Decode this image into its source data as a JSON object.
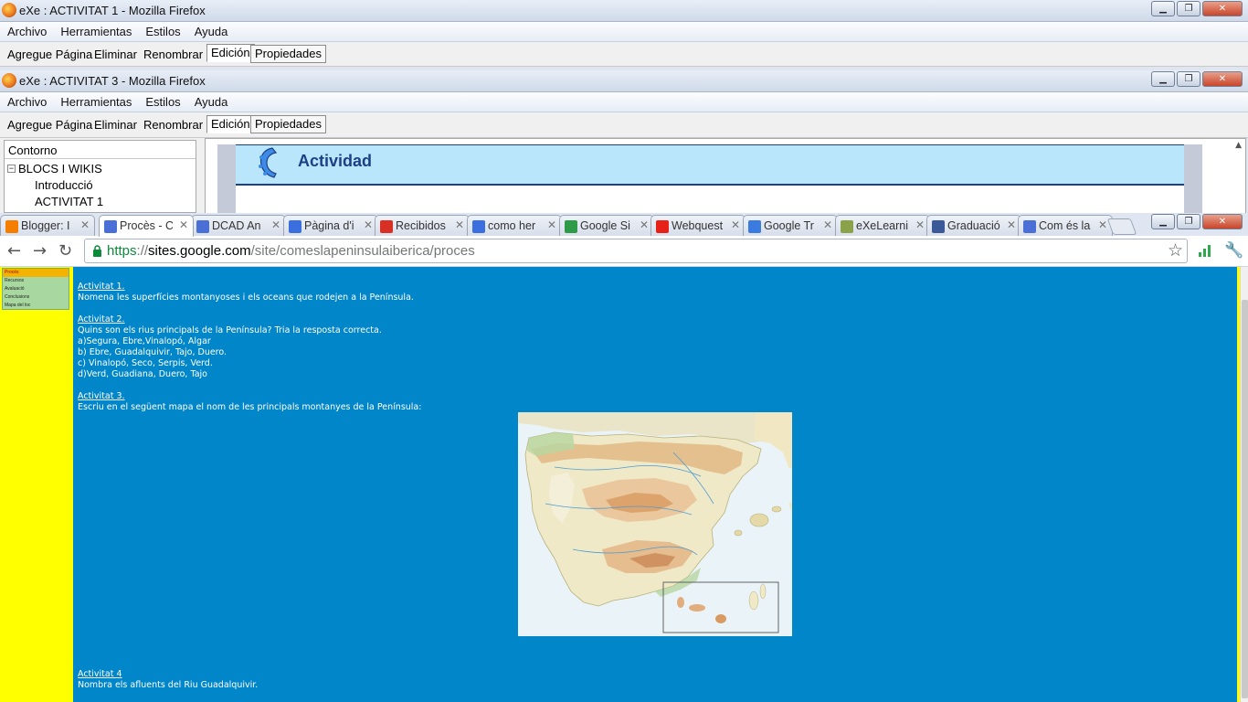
{
  "window1": {
    "title": "eXe : ACTIVITAT 1 - Mozilla Firefox",
    "menu": [
      "Archivo",
      "Herramientas",
      "Estilos",
      "Ayuda"
    ],
    "toolbar": [
      "Agregue Página",
      "Eliminar",
      "Renombrar"
    ],
    "tabs": [
      "Edición",
      "Propiedades"
    ]
  },
  "window2": {
    "title": "eXe : ACTIVITAT 3 - Mozilla Firefox",
    "menu": [
      "Archivo",
      "Herramientas",
      "Estilos",
      "Ayuda"
    ],
    "toolbar": [
      "Agregue Página",
      "Eliminar",
      "Renombrar"
    ],
    "tabs": [
      "Edición",
      "Propiedades"
    ],
    "outline": {
      "header": "Contorno",
      "root": "BLOCS I WIKIS",
      "children": [
        "Introducció",
        "ACTIVITAT 1"
      ]
    },
    "idevice_title": "Actividad"
  },
  "window_buttons": {
    "minimize": "▁",
    "maximize": "❐",
    "close": "✕"
  },
  "chrome": {
    "tabs": [
      {
        "label": "Blogger: I",
        "icon": "blogger-icon",
        "color": "#f57d00"
      },
      {
        "label": "Procès - C",
        "icon": "google-sites-icon",
        "color": "#4a6fd6"
      },
      {
        "label": "DCAD An",
        "icon": "google-sites-icon",
        "color": "#4a6fd6"
      },
      {
        "label": "Pàgina d'i",
        "icon": "google-docs-icon",
        "color": "#3b6fe0"
      },
      {
        "label": "Recibidos",
        "icon": "gmail-icon",
        "color": "#d93025"
      },
      {
        "label": "como her",
        "icon": "google-docs-icon",
        "color": "#3b6fe0"
      },
      {
        "label": "Google Si",
        "icon": "google-icon",
        "color": "#2f9a48"
      },
      {
        "label": "Webquest",
        "icon": "youtube-icon",
        "color": "#e62117"
      },
      {
        "label": "Google Tr",
        "icon": "google-translate-icon",
        "color": "#3b7be0"
      },
      {
        "label": "eXeLearni",
        "icon": "exe-icon",
        "color": "#8aa24a"
      },
      {
        "label": "Graduació",
        "icon": "facebook-icon",
        "color": "#3b5998"
      },
      {
        "label": "Com és la",
        "icon": "google-sites-icon",
        "color": "#4a6fd6"
      }
    ],
    "url_scheme": "https",
    "url_sep": "://",
    "url_host": "sites.google.com",
    "url_path": "/site/comeslapeninsulaiberica/proces"
  },
  "sidebar": {
    "items": [
      "Procés",
      "Recursos",
      "Avaluació",
      "Conclusions",
      "Mapa del loc"
    ]
  },
  "content": {
    "a1_title": "Activitat 1.",
    "a1_text": "Nomena les superfícies montanyoses i els oceans que rodejen a la Península.",
    "a2_title": "Activitat 2.",
    "a2_lines": [
      "Quins son els rius principals de la Península? Tria la resposta correcta.",
      "a)Segura, Ebre,Vinalopó, Algar",
      "b) Ebre, Guadalquivir, Tajo, Duero.",
      "c) Vinalopó, Seco, Serpis, Verd.",
      "d)Verd, Guadiana, Duero, Tajo"
    ],
    "a3_title": "Activitat 3.",
    "a3_text": "Escriu en el següent mapa el nom de les principals montanyes de la Península:",
    "a4_title": "Activitat 4",
    "a4_text": "Nombra els afluents del Riu Guadalquivir."
  },
  "colors": {
    "content_bg": "#0086c9",
    "sidebar_bg": "#ffff00",
    "idevice_header": "#b9e6fb",
    "ssl_green": "#0b8a3a"
  }
}
